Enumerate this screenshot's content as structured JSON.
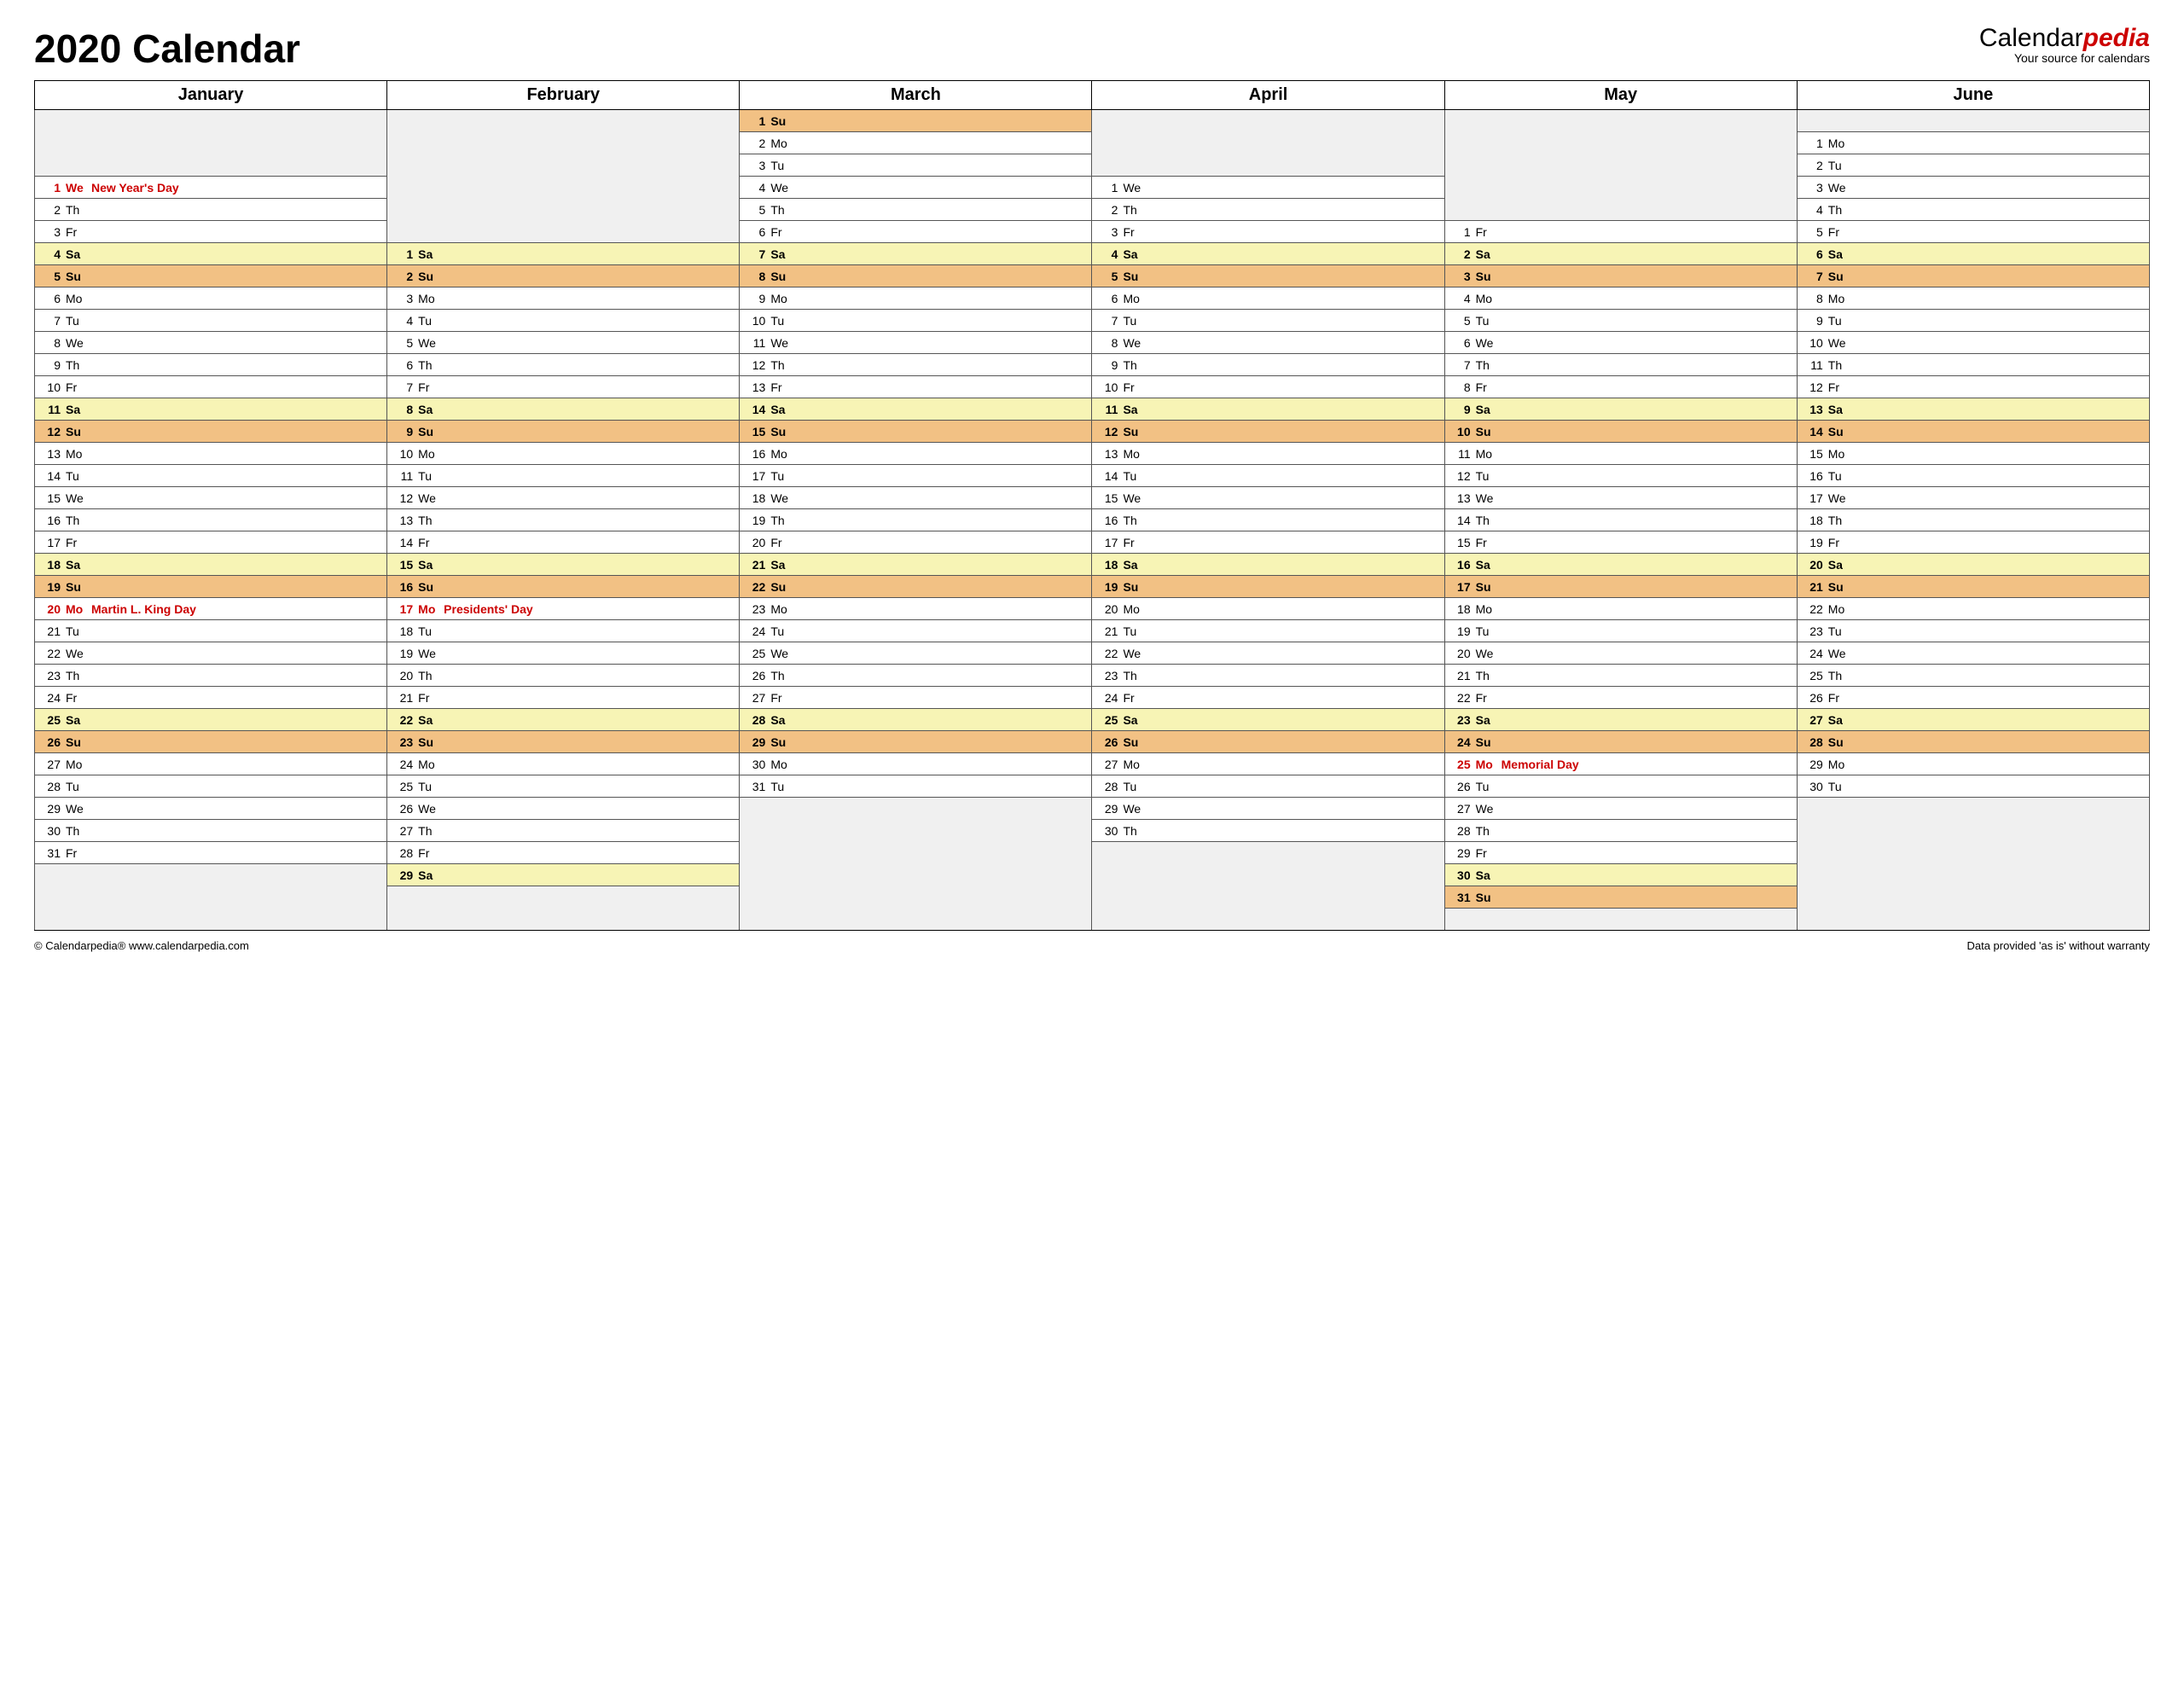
{
  "title": "2020 Calendar",
  "brand": {
    "main": "Calendar",
    "accent": "pedia",
    "sub": "Your source for calendars"
  },
  "footer": {
    "left": "© Calendarpedia®   www.calendarpedia.com",
    "right": "Data provided 'as is' without warranty"
  },
  "months": [
    "January",
    "February",
    "March",
    "April",
    "May",
    "June"
  ],
  "calendar": {
    "rows": 37,
    "columns": [
      {
        "month": "January",
        "startRow": 3,
        "days": [
          {
            "n": 1,
            "dow": "We",
            "holiday": "New Year's Day"
          },
          {
            "n": 2,
            "dow": "Th"
          },
          {
            "n": 3,
            "dow": "Fr"
          },
          {
            "n": 4,
            "dow": "Sa"
          },
          {
            "n": 5,
            "dow": "Su"
          },
          {
            "n": 6,
            "dow": "Mo"
          },
          {
            "n": 7,
            "dow": "Tu"
          },
          {
            "n": 8,
            "dow": "We"
          },
          {
            "n": 9,
            "dow": "Th"
          },
          {
            "n": 10,
            "dow": "Fr"
          },
          {
            "n": 11,
            "dow": "Sa"
          },
          {
            "n": 12,
            "dow": "Su"
          },
          {
            "n": 13,
            "dow": "Mo"
          },
          {
            "n": 14,
            "dow": "Tu"
          },
          {
            "n": 15,
            "dow": "We"
          },
          {
            "n": 16,
            "dow": "Th"
          },
          {
            "n": 17,
            "dow": "Fr"
          },
          {
            "n": 18,
            "dow": "Sa"
          },
          {
            "n": 19,
            "dow": "Su"
          },
          {
            "n": 20,
            "dow": "Mo",
            "holiday": "Martin L. King Day"
          },
          {
            "n": 21,
            "dow": "Tu"
          },
          {
            "n": 22,
            "dow": "We"
          },
          {
            "n": 23,
            "dow": "Th"
          },
          {
            "n": 24,
            "dow": "Fr"
          },
          {
            "n": 25,
            "dow": "Sa"
          },
          {
            "n": 26,
            "dow": "Su"
          },
          {
            "n": 27,
            "dow": "Mo"
          },
          {
            "n": 28,
            "dow": "Tu"
          },
          {
            "n": 29,
            "dow": "We"
          },
          {
            "n": 30,
            "dow": "Th"
          },
          {
            "n": 31,
            "dow": "Fr"
          }
        ]
      },
      {
        "month": "February",
        "startRow": 6,
        "days": [
          {
            "n": 1,
            "dow": "Sa"
          },
          {
            "n": 2,
            "dow": "Su"
          },
          {
            "n": 3,
            "dow": "Mo"
          },
          {
            "n": 4,
            "dow": "Tu"
          },
          {
            "n": 5,
            "dow": "We"
          },
          {
            "n": 6,
            "dow": "Th"
          },
          {
            "n": 7,
            "dow": "Fr"
          },
          {
            "n": 8,
            "dow": "Sa"
          },
          {
            "n": 9,
            "dow": "Su"
          },
          {
            "n": 10,
            "dow": "Mo"
          },
          {
            "n": 11,
            "dow": "Tu"
          },
          {
            "n": 12,
            "dow": "We"
          },
          {
            "n": 13,
            "dow": "Th"
          },
          {
            "n": 14,
            "dow": "Fr"
          },
          {
            "n": 15,
            "dow": "Sa"
          },
          {
            "n": 16,
            "dow": "Su"
          },
          {
            "n": 17,
            "dow": "Mo",
            "holiday": "Presidents' Day"
          },
          {
            "n": 18,
            "dow": "Tu"
          },
          {
            "n": 19,
            "dow": "We"
          },
          {
            "n": 20,
            "dow": "Th"
          },
          {
            "n": 21,
            "dow": "Fr"
          },
          {
            "n": 22,
            "dow": "Sa"
          },
          {
            "n": 23,
            "dow": "Su"
          },
          {
            "n": 24,
            "dow": "Mo"
          },
          {
            "n": 25,
            "dow": "Tu"
          },
          {
            "n": 26,
            "dow": "We"
          },
          {
            "n": 27,
            "dow": "Th"
          },
          {
            "n": 28,
            "dow": "Fr"
          },
          {
            "n": 29,
            "dow": "Sa"
          }
        ]
      },
      {
        "month": "March",
        "startRow": 0,
        "days": [
          {
            "n": 1,
            "dow": "Su"
          },
          {
            "n": 2,
            "dow": "Mo"
          },
          {
            "n": 3,
            "dow": "Tu"
          },
          {
            "n": 4,
            "dow": "We"
          },
          {
            "n": 5,
            "dow": "Th"
          },
          {
            "n": 6,
            "dow": "Fr"
          },
          {
            "n": 7,
            "dow": "Sa"
          },
          {
            "n": 8,
            "dow": "Su"
          },
          {
            "n": 9,
            "dow": "Mo"
          },
          {
            "n": 10,
            "dow": "Tu"
          },
          {
            "n": 11,
            "dow": "We"
          },
          {
            "n": 12,
            "dow": "Th"
          },
          {
            "n": 13,
            "dow": "Fr"
          },
          {
            "n": 14,
            "dow": "Sa"
          },
          {
            "n": 15,
            "dow": "Su"
          },
          {
            "n": 16,
            "dow": "Mo"
          },
          {
            "n": 17,
            "dow": "Tu"
          },
          {
            "n": 18,
            "dow": "We"
          },
          {
            "n": 19,
            "dow": "Th"
          },
          {
            "n": 20,
            "dow": "Fr"
          },
          {
            "n": 21,
            "dow": "Sa"
          },
          {
            "n": 22,
            "dow": "Su"
          },
          {
            "n": 23,
            "dow": "Mo"
          },
          {
            "n": 24,
            "dow": "Tu"
          },
          {
            "n": 25,
            "dow": "We"
          },
          {
            "n": 26,
            "dow": "Th"
          },
          {
            "n": 27,
            "dow": "Fr"
          },
          {
            "n": 28,
            "dow": "Sa"
          },
          {
            "n": 29,
            "dow": "Su"
          },
          {
            "n": 30,
            "dow": "Mo"
          },
          {
            "n": 31,
            "dow": "Tu"
          }
        ]
      },
      {
        "month": "April",
        "startRow": 3,
        "days": [
          {
            "n": 1,
            "dow": "We"
          },
          {
            "n": 2,
            "dow": "Th"
          },
          {
            "n": 3,
            "dow": "Fr"
          },
          {
            "n": 4,
            "dow": "Sa"
          },
          {
            "n": 5,
            "dow": "Su"
          },
          {
            "n": 6,
            "dow": "Mo"
          },
          {
            "n": 7,
            "dow": "Tu"
          },
          {
            "n": 8,
            "dow": "We"
          },
          {
            "n": 9,
            "dow": "Th"
          },
          {
            "n": 10,
            "dow": "Fr"
          },
          {
            "n": 11,
            "dow": "Sa"
          },
          {
            "n": 12,
            "dow": "Su"
          },
          {
            "n": 13,
            "dow": "Mo"
          },
          {
            "n": 14,
            "dow": "Tu"
          },
          {
            "n": 15,
            "dow": "We"
          },
          {
            "n": 16,
            "dow": "Th"
          },
          {
            "n": 17,
            "dow": "Fr"
          },
          {
            "n": 18,
            "dow": "Sa"
          },
          {
            "n": 19,
            "dow": "Su"
          },
          {
            "n": 20,
            "dow": "Mo"
          },
          {
            "n": 21,
            "dow": "Tu"
          },
          {
            "n": 22,
            "dow": "We"
          },
          {
            "n": 23,
            "dow": "Th"
          },
          {
            "n": 24,
            "dow": "Fr"
          },
          {
            "n": 25,
            "dow": "Sa"
          },
          {
            "n": 26,
            "dow": "Su"
          },
          {
            "n": 27,
            "dow": "Mo"
          },
          {
            "n": 28,
            "dow": "Tu"
          },
          {
            "n": 29,
            "dow": "We"
          },
          {
            "n": 30,
            "dow": "Th"
          }
        ]
      },
      {
        "month": "May",
        "startRow": 5,
        "days": [
          {
            "n": 1,
            "dow": "Fr"
          },
          {
            "n": 2,
            "dow": "Sa"
          },
          {
            "n": 3,
            "dow": "Su"
          },
          {
            "n": 4,
            "dow": "Mo"
          },
          {
            "n": 5,
            "dow": "Tu"
          },
          {
            "n": 6,
            "dow": "We"
          },
          {
            "n": 7,
            "dow": "Th"
          },
          {
            "n": 8,
            "dow": "Fr"
          },
          {
            "n": 9,
            "dow": "Sa"
          },
          {
            "n": 10,
            "dow": "Su"
          },
          {
            "n": 11,
            "dow": "Mo"
          },
          {
            "n": 12,
            "dow": "Tu"
          },
          {
            "n": 13,
            "dow": "We"
          },
          {
            "n": 14,
            "dow": "Th"
          },
          {
            "n": 15,
            "dow": "Fr"
          },
          {
            "n": 16,
            "dow": "Sa"
          },
          {
            "n": 17,
            "dow": "Su"
          },
          {
            "n": 18,
            "dow": "Mo"
          },
          {
            "n": 19,
            "dow": "Tu"
          },
          {
            "n": 20,
            "dow": "We"
          },
          {
            "n": 21,
            "dow": "Th"
          },
          {
            "n": 22,
            "dow": "Fr"
          },
          {
            "n": 23,
            "dow": "Sa"
          },
          {
            "n": 24,
            "dow": "Su"
          },
          {
            "n": 25,
            "dow": "Mo",
            "holiday": "Memorial Day"
          },
          {
            "n": 26,
            "dow": "Tu"
          },
          {
            "n": 27,
            "dow": "We"
          },
          {
            "n": 28,
            "dow": "Th"
          },
          {
            "n": 29,
            "dow": "Fr"
          },
          {
            "n": 30,
            "dow": "Sa"
          },
          {
            "n": 31,
            "dow": "Su"
          }
        ]
      },
      {
        "month": "June",
        "startRow": 1,
        "days": [
          {
            "n": 1,
            "dow": "Mo"
          },
          {
            "n": 2,
            "dow": "Tu"
          },
          {
            "n": 3,
            "dow": "We"
          },
          {
            "n": 4,
            "dow": "Th"
          },
          {
            "n": 5,
            "dow": "Fr"
          },
          {
            "n": 6,
            "dow": "Sa"
          },
          {
            "n": 7,
            "dow": "Su"
          },
          {
            "n": 8,
            "dow": "Mo"
          },
          {
            "n": 9,
            "dow": "Tu"
          },
          {
            "n": 10,
            "dow": "We"
          },
          {
            "n": 11,
            "dow": "Th"
          },
          {
            "n": 12,
            "dow": "Fr"
          },
          {
            "n": 13,
            "dow": "Sa"
          },
          {
            "n": 14,
            "dow": "Su"
          },
          {
            "n": 15,
            "dow": "Mo"
          },
          {
            "n": 16,
            "dow": "Tu"
          },
          {
            "n": 17,
            "dow": "We"
          },
          {
            "n": 18,
            "dow": "Th"
          },
          {
            "n": 19,
            "dow": "Fr"
          },
          {
            "n": 20,
            "dow": "Sa"
          },
          {
            "n": 21,
            "dow": "Su"
          },
          {
            "n": 22,
            "dow": "Mo"
          },
          {
            "n": 23,
            "dow": "Tu"
          },
          {
            "n": 24,
            "dow": "We"
          },
          {
            "n": 25,
            "dow": "Th"
          },
          {
            "n": 26,
            "dow": "Fr"
          },
          {
            "n": 27,
            "dow": "Sa"
          },
          {
            "n": 28,
            "dow": "Su"
          },
          {
            "n": 29,
            "dow": "Mo"
          },
          {
            "n": 30,
            "dow": "Tu"
          }
        ]
      }
    ]
  }
}
